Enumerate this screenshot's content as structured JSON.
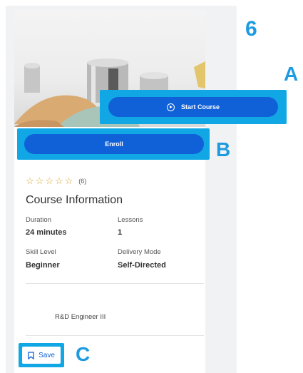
{
  "step_number": "6",
  "markers": {
    "a": "A",
    "b": "B",
    "c": "C"
  },
  "buttons": {
    "start_course": "Start Course",
    "enroll": "Enroll",
    "save": "Save"
  },
  "icons": {
    "start_course": "play-circle-icon",
    "save": "bookmark-icon",
    "rating": "star-icon"
  },
  "rating": {
    "stars": 5,
    "count": "(6)"
  },
  "course_info": {
    "title": "Course Information",
    "duration_label": "Duration",
    "duration_value": "24 minutes",
    "lessons_label": "Lessons",
    "lessons_value": "1",
    "skill_label": "Skill Level",
    "skill_value": "Beginner",
    "delivery_label": "Delivery Mode",
    "delivery_value": "Self-Directed"
  },
  "job_role": "R&D Engineer III",
  "colors": {
    "accent": "#10a7e4",
    "button": "#1061d8",
    "star": "#d9a62a"
  }
}
